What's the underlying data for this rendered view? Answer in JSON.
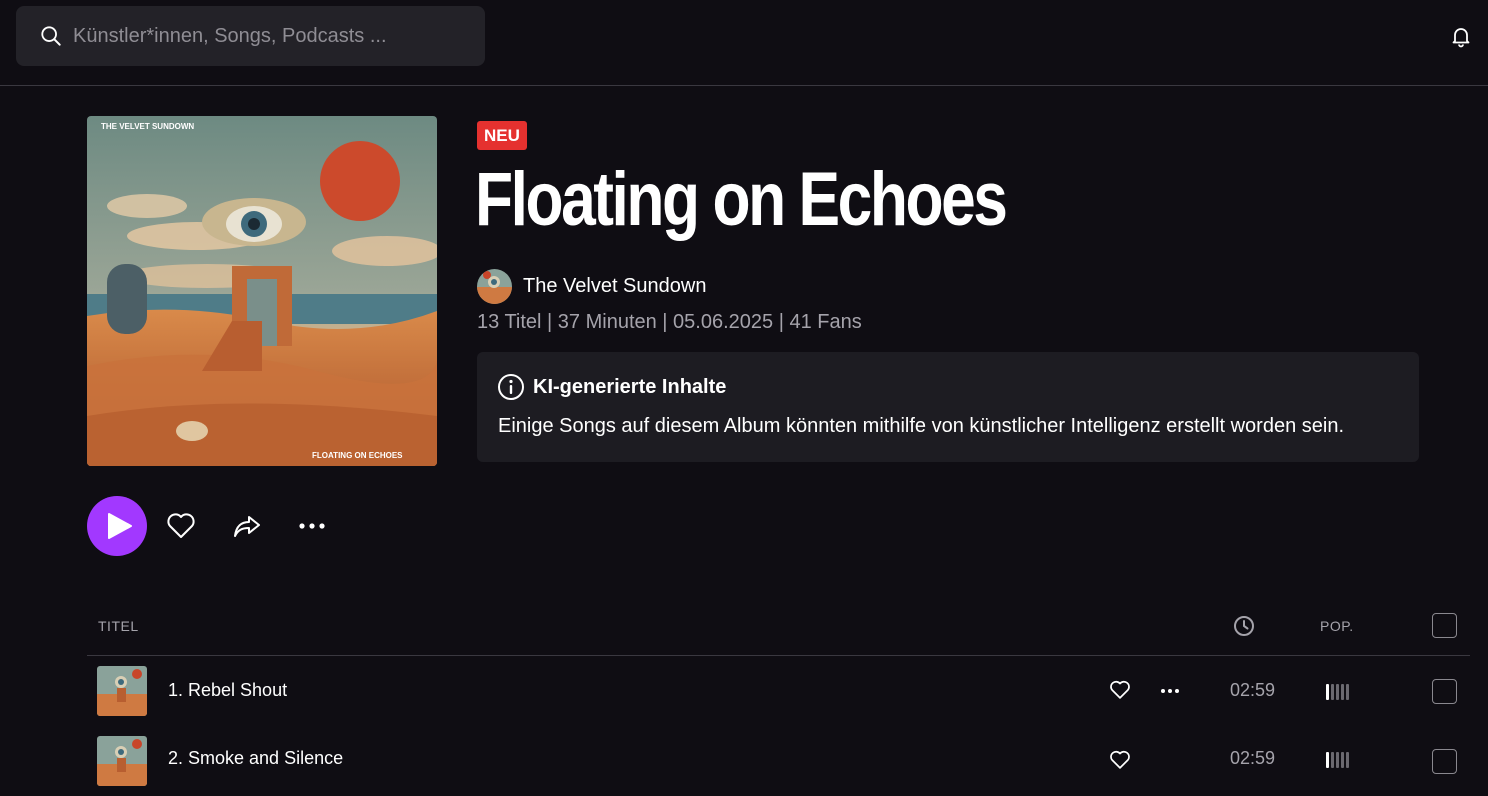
{
  "search": {
    "placeholder": "Künstler*innen, Songs, Podcasts ..."
  },
  "album": {
    "badge": "NEU",
    "title": "Floating on Echoes",
    "artist": "The Velvet Sundown",
    "meta": "13 Titel | 37 Minuten | 05.06.2025 | 41 Fans",
    "cover_band_text": "THE VELVET SUNDOWN",
    "cover_album_text": "FLOATING ON ECHOES"
  },
  "ai_notice": {
    "title": "KI-generierte Inhalte",
    "text": "Einige Songs auf diesem Album könnten mithilfe von künstlicher Intelligenz erstellt worden sein."
  },
  "table": {
    "col_title": "TITEL",
    "col_pop": "POP.",
    "tracks": [
      {
        "title": "1. Rebel Shout",
        "duration": "02:59",
        "popularity": 0.2
      },
      {
        "title": "2. Smoke and Silence",
        "duration": "02:59",
        "popularity": 0.2
      }
    ]
  },
  "colors": {
    "accent": "#a238ff",
    "badge": "#e5312f",
    "background": "#0f0d13"
  }
}
